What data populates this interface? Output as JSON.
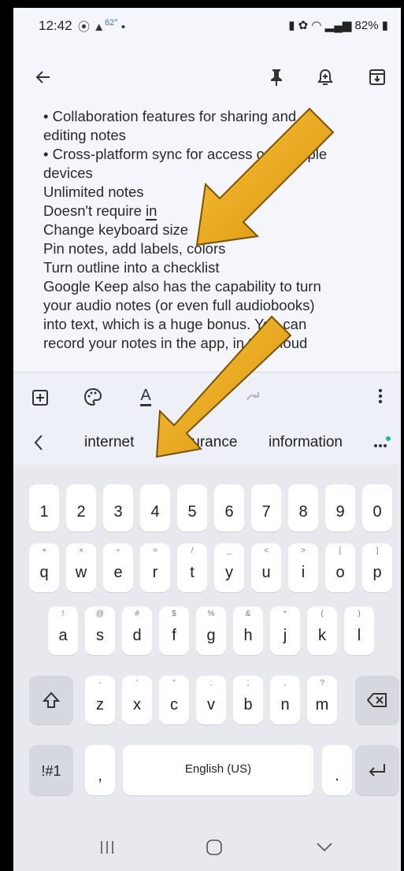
{
  "status_bar": {
    "time": "12:42",
    "temperature": "62°",
    "battery": "82%"
  },
  "note": {
    "lines": [
      "• Collaboration features for sharing and",
      "editing notes",
      "• Cross-platform sync for access on multiple",
      "devices",
      "Unlimited notes",
      "Doesn't require in",
      "Change keyboard size",
      "Pin notes, add labels, colors",
      "Turn outline into a checklist",
      "Google Keep also has the capability to turn",
      "your audio notes (or even full audiobooks)",
      "into text, which is a huge bonus. You can",
      "record your notes in the app, in the cloud"
    ],
    "line6_prefix": "Doesn't require ",
    "line6_underlined": "in"
  },
  "suggestions": [
    "internet",
    "insurance",
    "information"
  ],
  "keyboard": {
    "numbers": [
      "1",
      "2",
      "3",
      "4",
      "5",
      "6",
      "7",
      "8",
      "9",
      "0"
    ],
    "row1": [
      {
        "k": "q",
        "s": "+"
      },
      {
        "k": "w",
        "s": "×"
      },
      {
        "k": "e",
        "s": "÷"
      },
      {
        "k": "r",
        "s": "="
      },
      {
        "k": "t",
        "s": "/"
      },
      {
        "k": "y",
        "s": "_"
      },
      {
        "k": "u",
        "s": "<"
      },
      {
        "k": "i",
        "s": ">"
      },
      {
        "k": "o",
        "s": "["
      },
      {
        "k": "p",
        "s": "]"
      }
    ],
    "row2": [
      {
        "k": "a",
        "s": "!"
      },
      {
        "k": "s",
        "s": "@"
      },
      {
        "k": "d",
        "s": "#"
      },
      {
        "k": "f",
        "s": "$"
      },
      {
        "k": "g",
        "s": "%"
      },
      {
        "k": "h",
        "s": "&"
      },
      {
        "k": "j",
        "s": "*"
      },
      {
        "k": "k",
        "s": "("
      },
      {
        "k": "l",
        "s": ")"
      }
    ],
    "row3": [
      {
        "k": "z",
        "s": "-"
      },
      {
        "k": "x",
        "s": "'"
      },
      {
        "k": "c",
        "s": "\""
      },
      {
        "k": "v",
        "s": ":"
      },
      {
        "k": "b",
        "s": ";"
      },
      {
        "k": "n",
        "s": ","
      },
      {
        "k": "m",
        "s": "?"
      }
    ],
    "symbols_label": "!#1",
    "comma": ",",
    "space_label": "English (US)",
    "period": "."
  }
}
